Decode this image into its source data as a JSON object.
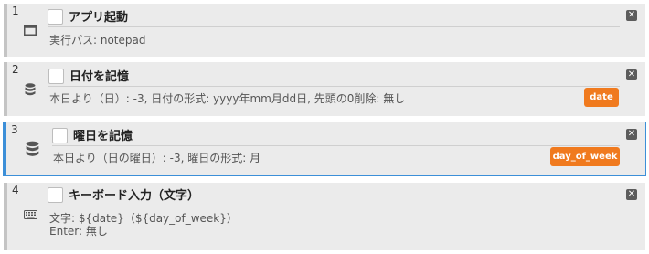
{
  "accent_color": "#f07a1e",
  "selected_border_color": "#3c8fd8",
  "steps": [
    {
      "number": "1",
      "icon": "window-icon",
      "title": "アプリ起動",
      "detail": "実行パス: notepad",
      "close_glyph": "✕"
    },
    {
      "number": "2",
      "icon": "database-icon",
      "title": "日付を記憶",
      "detail": "本日より（日）: -3, 日付の形式: yyyy年mm月dd日, 先頭の0削除: 無し",
      "badge": "date",
      "close_glyph": "✕"
    },
    {
      "number": "3",
      "icon": "database-icon",
      "title": "曜日を記憶",
      "detail": "本日より（日の曜日）: -3, 曜日の形式: 月",
      "badge": "day_of_week",
      "close_glyph": "✕",
      "selected": true
    },
    {
      "number": "4",
      "icon": "keyboard-icon",
      "title": "キーボード入力（文字）",
      "detail_lines": [
        "文字: ${date}（${day_of_week}）",
        "Enter: 無し"
      ],
      "close_glyph": "✕"
    }
  ]
}
